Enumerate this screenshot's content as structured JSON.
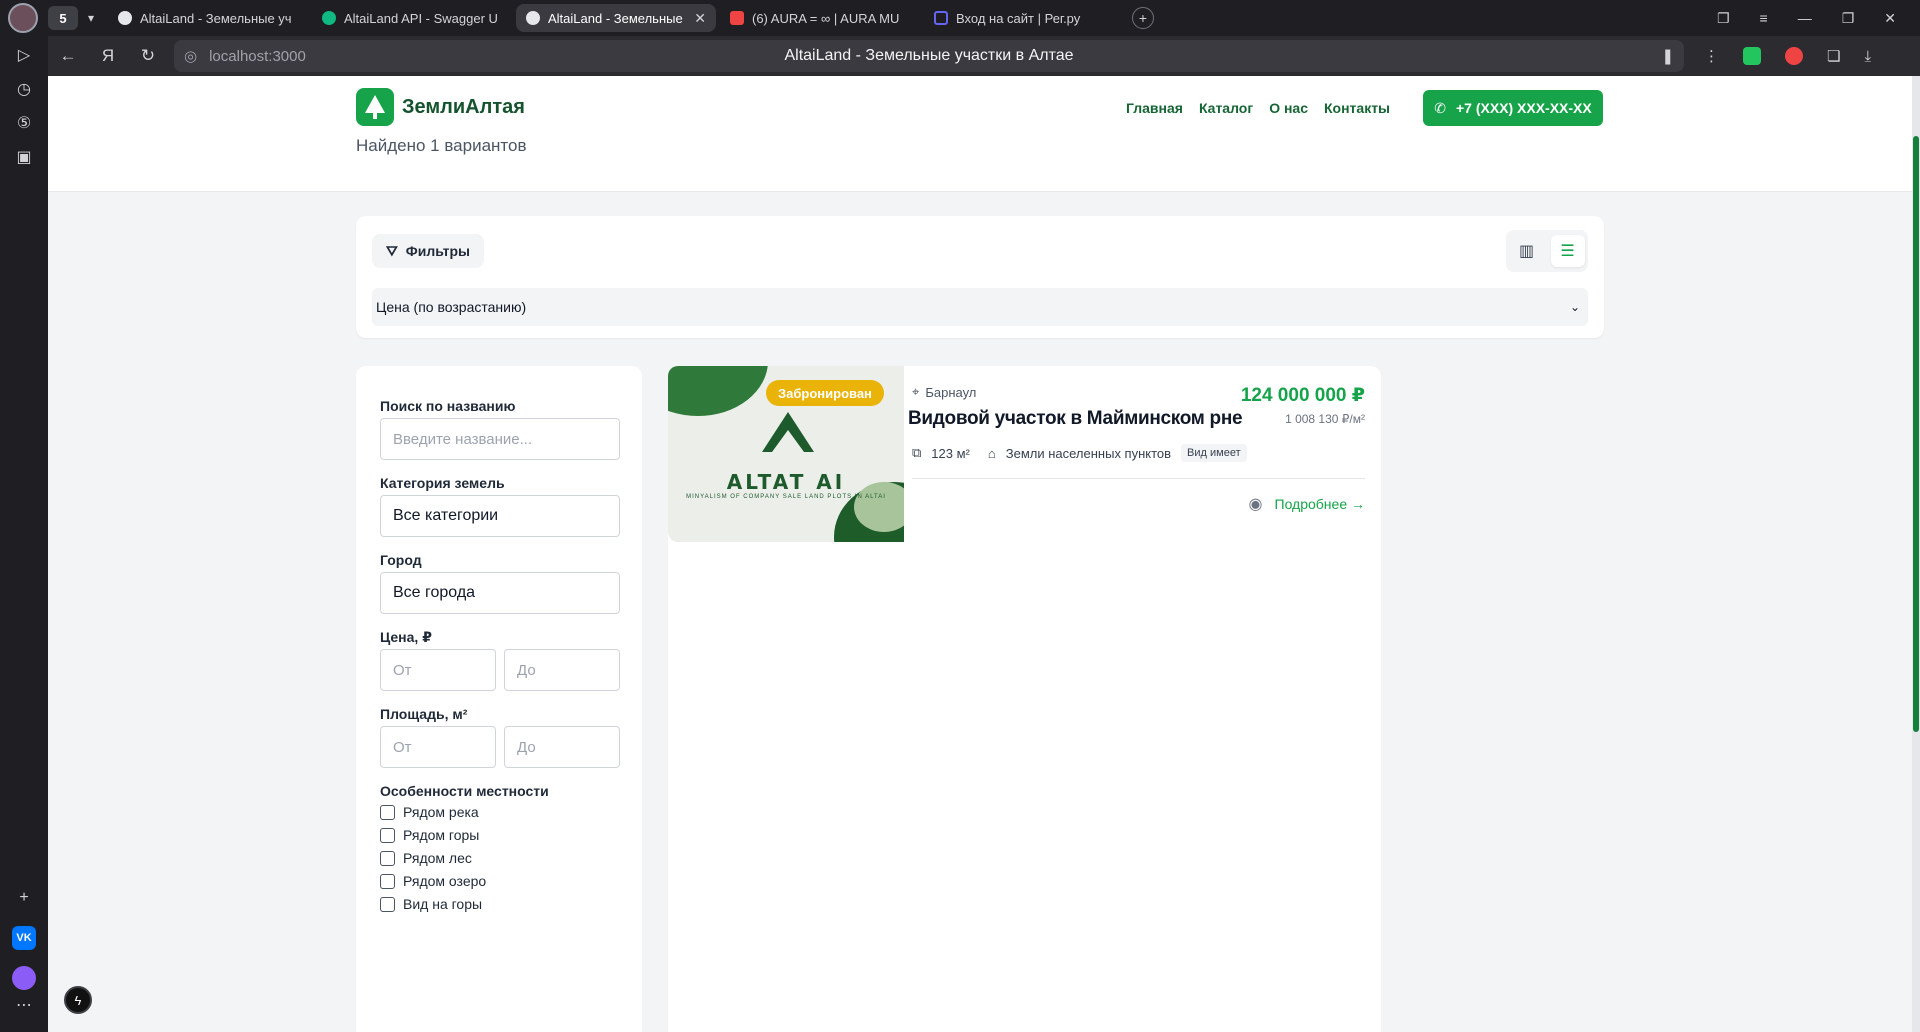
{
  "browser": {
    "group_label": "5",
    "tabs": [
      {
        "title": "AltaiLand - Земельные уч",
        "active": false,
        "color": "#e5e7eb"
      },
      {
        "title": "AltaiLand API - Swagger U",
        "active": false,
        "color": "#10b981"
      },
      {
        "title": "AltaiLand - Земельные",
        "active": true,
        "color": "#e5e7eb"
      },
      {
        "title": "(6) AURA = ∞ | AURA MU",
        "active": false,
        "color": "#ef4444"
      },
      {
        "title": "Вход на сайт | Рег.ру",
        "active": false,
        "color": "#6366f1"
      }
    ],
    "url": "localhost:3000",
    "page_title": "AltaiLand - Земельные участки в Алтае"
  },
  "header": {
    "logo_text": "ЗемлиАлтая",
    "nav": [
      "Главная",
      "Каталог",
      "О нас",
      "Контакты"
    ],
    "phone": "+7 (XXX) XXX-XX-XX",
    "found_text": "Найдено 1 вариантов"
  },
  "toolbar": {
    "filters_label": "Фильтры",
    "sort_value": "Цена (по возрастанию)",
    "view_mode": "list"
  },
  "filters": {
    "search_label": "Поиск по названию",
    "search_placeholder": "Введите название...",
    "category_label": "Категория земель",
    "category_value": "Все категории",
    "city_label": "Город",
    "city_value": "Все города",
    "price_label": "Цена, ₽",
    "area_label": "Площадь, м²",
    "from_placeholder": "От",
    "to_placeholder": "До",
    "features_label": "Особенности местности",
    "features": [
      "Рядом река",
      "Рядом горы",
      "Рядом лес",
      "Рядом озеро",
      "Вид на горы"
    ]
  },
  "listing": {
    "status_badge": "Забронирован",
    "image_brand": "ALTAT AI",
    "image_sub": "MINYALISM OF COMPANY SALE LAND PLOTS IN ALTAI",
    "city": "Барнаул",
    "title": "Видовой участок в Майминском рне",
    "price": "124 000 000 ₽",
    "price_per_m2": "1 008 130 ₽/м²",
    "area": "123 м²",
    "category": "Земли населенных пунктов",
    "tag": "Вид имеет",
    "details_link": "Подробнее →"
  },
  "colors": {
    "brand_green": "#16a34a",
    "badge_yellow": "#eab308"
  }
}
